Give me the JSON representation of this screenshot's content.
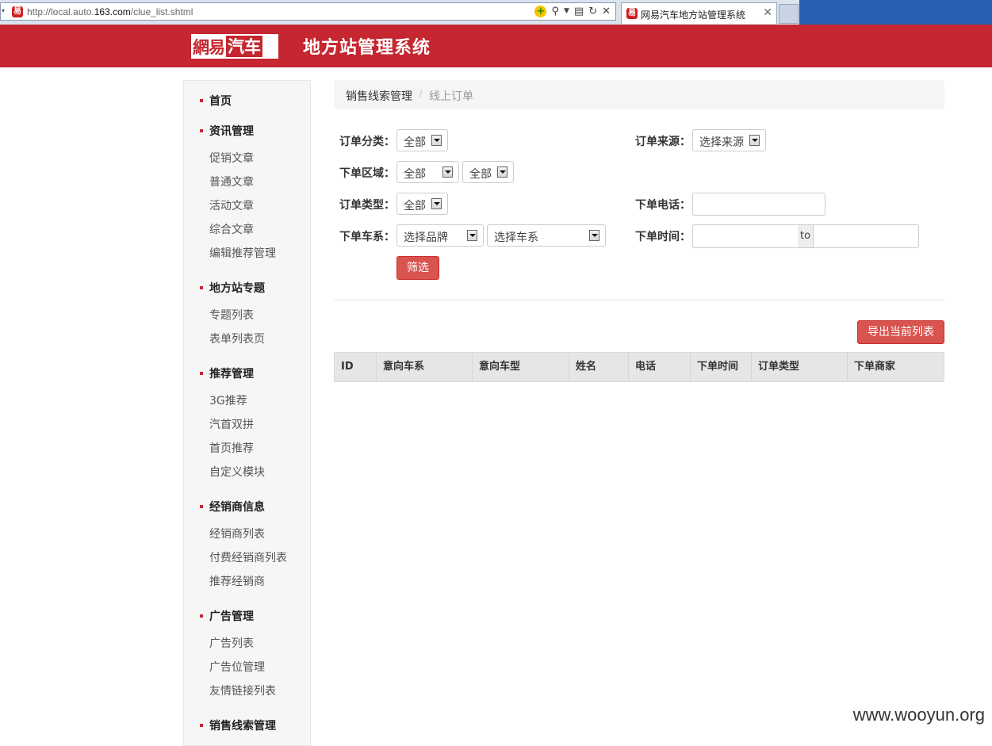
{
  "browser": {
    "url_prefix": "http://local.auto.",
    "url_domain": "163.com",
    "url_path": "/clue_list.shtml",
    "tab_title": "网易汽车地方站管理系统",
    "favicon_char": "易"
  },
  "header": {
    "logo_part1": "網易",
    "logo_part2": "汽车",
    "site_title": "地方站管理系统"
  },
  "sidebar": {
    "sections": [
      {
        "title": "首页",
        "items": []
      },
      {
        "title": "资讯管理",
        "items": [
          "促销文章",
          "普通文章",
          "活动文章",
          "综合文章",
          "编辑推荐管理"
        ]
      },
      {
        "title": "地方站专题",
        "items": [
          "专题列表",
          "表单列表页"
        ]
      },
      {
        "title": "推荐管理",
        "items": [
          "3G推荐",
          "汽首双拼",
          "首页推荐",
          "自定义模块"
        ]
      },
      {
        "title": "经销商信息",
        "items": [
          "经销商列表",
          "付费经销商列表",
          "推荐经销商"
        ]
      },
      {
        "title": "广告管理",
        "items": [
          "广告列表",
          "广告位管理",
          "友情链接列表"
        ]
      },
      {
        "title": "销售线索管理",
        "items": []
      }
    ]
  },
  "breadcrumb": {
    "parent": "销售线索管理",
    "separator": "/",
    "current": "线上订单"
  },
  "filters": {
    "order_category_label": "订单分类：",
    "order_category_value": "全部",
    "order_source_label": "订单来源：",
    "order_source_value": "选择来源",
    "region_label": "下单区域：",
    "region_province": "全部",
    "region_city": "全部",
    "order_type_label": "订单类型：",
    "order_type_value": "全部",
    "phone_label": "下单电话：",
    "phone_value": "",
    "series_label": "下单车系：",
    "brand_value": "选择品牌",
    "series_value": "选择车系",
    "time_label": "下单时间：",
    "time_from": "",
    "time_to_text": "to",
    "time_to": "",
    "filter_button": "筛选"
  },
  "export_button": "导出当前列表",
  "table": {
    "columns": [
      "ID",
      "意向车系",
      "意向车型",
      "姓名",
      "电话",
      "下单时间",
      "订单类型",
      "下单商家"
    ],
    "rows": []
  },
  "watermark": "www.wooyun.org",
  "colors": {
    "brand_red": "#c5262f",
    "button_red": "#d9534f"
  }
}
